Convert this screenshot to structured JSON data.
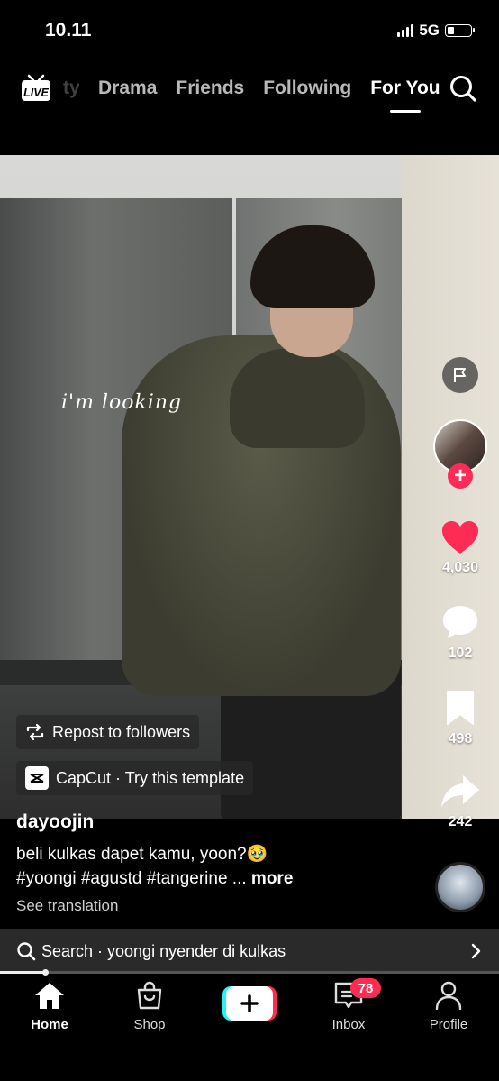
{
  "status_bar": {
    "time": "10.11",
    "network": "5G"
  },
  "top_nav": {
    "partial_tab": "ty",
    "tabs": [
      {
        "label": "Drama",
        "active": false
      },
      {
        "label": "Friends",
        "active": false
      },
      {
        "label": "Following",
        "active": false
      },
      {
        "label": "For You",
        "active": true
      }
    ],
    "live_label": "LIVE"
  },
  "video": {
    "overlay_text": "i'm looking",
    "repost_chip": "Repost to followers",
    "capcut_chip": "CapCut · Try this template"
  },
  "actions": {
    "likes": "4,030",
    "comments": "102",
    "saves": "498",
    "shares": "242"
  },
  "caption": {
    "username": "dayoojin",
    "text": "beli kulkas dapet kamu, yoon?🥹",
    "hashtags": "#yoongi #agustd #tangerine ...",
    "more": "more",
    "see_translation": "See translation"
  },
  "search_bar": {
    "text": "Search · yoongi nyender di kulkas"
  },
  "playback": {
    "progress": 0.09
  },
  "bottom_nav": {
    "home": "Home",
    "shop": "Shop",
    "inbox": "Inbox",
    "profile": "Profile",
    "inbox_badge": "78"
  },
  "colors": {
    "accent": "#fe2c55",
    "like_red": "#fe2c55",
    "cyan": "#25f4ee"
  }
}
